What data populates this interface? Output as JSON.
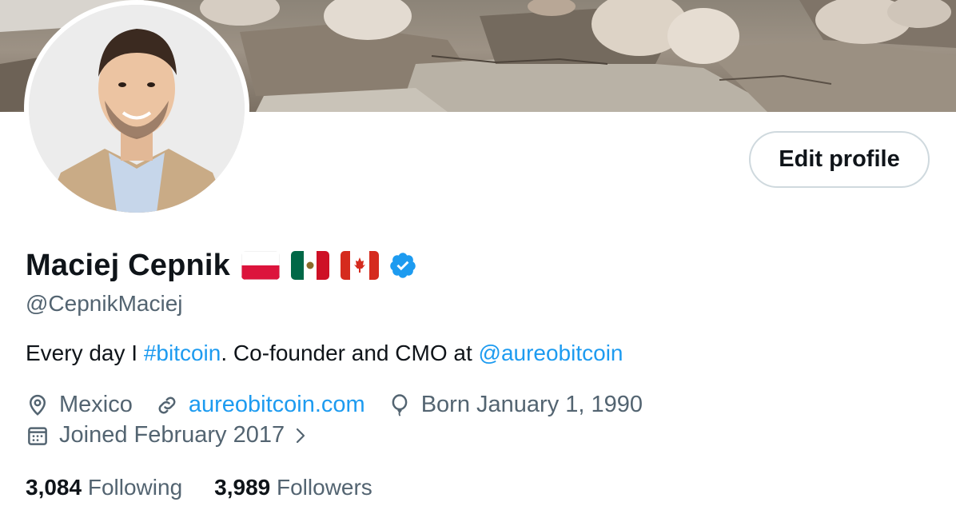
{
  "profile": {
    "name": "Maciej Cepnik",
    "handle": "@CepnikMaciej",
    "flags": [
      "poland-flag-icon",
      "mexico-flag-icon",
      "canada-flag-icon"
    ],
    "verified_icon": "verified-badge-icon",
    "edit_label": "Edit profile"
  },
  "bio": {
    "prefix": "Every day I ",
    "hashtag": "#bitcoin",
    "middle": ". Co-founder and CMO at ",
    "mention": "@aureobitcoin"
  },
  "meta": {
    "location": "Mexico",
    "website": "aureobitcoin.com",
    "born": "Born January 1, 1990",
    "joined": "Joined February 2017"
  },
  "stats": {
    "following_count": "3,084",
    "following_label": "Following",
    "followers_count": "3,989",
    "followers_label": "Followers"
  },
  "colors": {
    "accent": "#1d9bf0",
    "text_primary": "#0f1419",
    "text_secondary": "#536471",
    "border": "#cfd9de"
  }
}
